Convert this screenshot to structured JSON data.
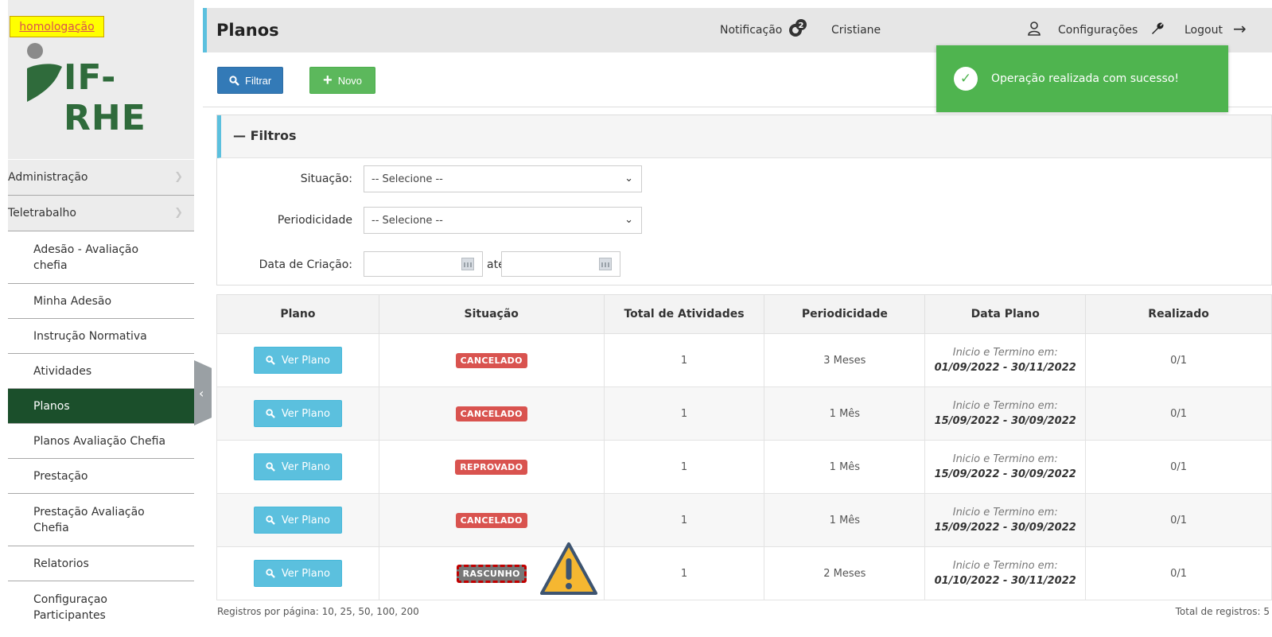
{
  "environment_badge": "homologação",
  "logo_text": "IF-RHE",
  "sidebar": {
    "items": [
      {
        "label": "Administração",
        "level": "top"
      },
      {
        "label": "Teletrabalho",
        "level": "top"
      },
      {
        "label": "Adesão - Avaliação chefia",
        "level": "sub"
      },
      {
        "label": "Minha Adesão",
        "level": "sub"
      },
      {
        "label": "Instrução Normativa",
        "level": "sub"
      },
      {
        "label": "Atividades",
        "level": "sub"
      },
      {
        "label": "Planos",
        "level": "sub",
        "active": true
      },
      {
        "label": "Planos Avaliação Chefia",
        "level": "sub"
      },
      {
        "label": "Prestação",
        "level": "sub"
      },
      {
        "label": "Prestação Avaliação Chefia",
        "level": "sub"
      },
      {
        "label": "Relatorios",
        "level": "sub"
      },
      {
        "label": "Configuraçao Participantes",
        "level": "sub"
      }
    ]
  },
  "header": {
    "title": "Planos",
    "notification_label": "Notificação",
    "notification_count": "2",
    "user_name": "Cristiane",
    "settings_label": "Configurações",
    "logout_label": "Logout"
  },
  "toolbar": {
    "filter_label": "Filtrar",
    "new_label": "Novo"
  },
  "toast": {
    "message": "Operação realizada com sucesso!"
  },
  "filters": {
    "title": "Filtros",
    "situacao_label": "Situação:",
    "situacao_value": "-- Selecione --",
    "periodicidade_label": "Periodicidade",
    "periodicidade_value": "-- Selecione --",
    "data_label": "Data de Criação:",
    "ate_label": "até"
  },
  "table": {
    "headers": [
      "Plano",
      "Situação",
      "Total de Atividades",
      "Periodicidade",
      "Data Plano",
      "Realizado"
    ],
    "rows": [
      {
        "button": "Ver Plano",
        "status": "CANCELADO",
        "status_color": "#d9534f",
        "total": "1",
        "periodicidade": "3 Meses",
        "date_label": "Inicio e Termino em:",
        "date_range": "01/09/2022 - 30/11/2022",
        "realizado": "0/1"
      },
      {
        "button": "Ver Plano",
        "status": "CANCELADO",
        "status_color": "#d9534f",
        "total": "1",
        "periodicidade": "1 Mês",
        "date_label": "Inicio e Termino em:",
        "date_range": "15/09/2022 - 30/09/2022",
        "realizado": "0/1"
      },
      {
        "button": "Ver Plano",
        "status": "REPROVADO",
        "status_color": "#d9534f",
        "total": "1",
        "periodicidade": "1 Mês",
        "date_label": "Inicio e Termino em:",
        "date_range": "15/09/2022 - 30/09/2022",
        "realizado": "0/1"
      },
      {
        "button": "Ver Plano",
        "status": "CANCELADO",
        "status_color": "#d9534f",
        "total": "1",
        "periodicidade": "1 Mês",
        "date_label": "Inicio e Termino em:",
        "date_range": "15/09/2022 - 30/09/2022",
        "realizado": "0/1"
      },
      {
        "button": "Ver Plano",
        "status": "RASCUNHO",
        "status_color": "#777777",
        "total": "1",
        "periodicidade": "2 Meses",
        "date_label": "Inicio e Termino em:",
        "date_range": "01/10/2022 - 30/11/2022",
        "realizado": "0/1"
      }
    ]
  },
  "footer": {
    "per_page": "Registros por página: 10, 25, 50, 100, 200",
    "total": "Total de registros: 5"
  },
  "icons": [
    "search-icon",
    "plus-icon",
    "check-icon",
    "bell-icon",
    "user-icon",
    "wrench-icon",
    "logout-arrow-icon",
    "chevron-down-icon",
    "calendar-icon",
    "warning-icon",
    "chevron-left-icon"
  ]
}
